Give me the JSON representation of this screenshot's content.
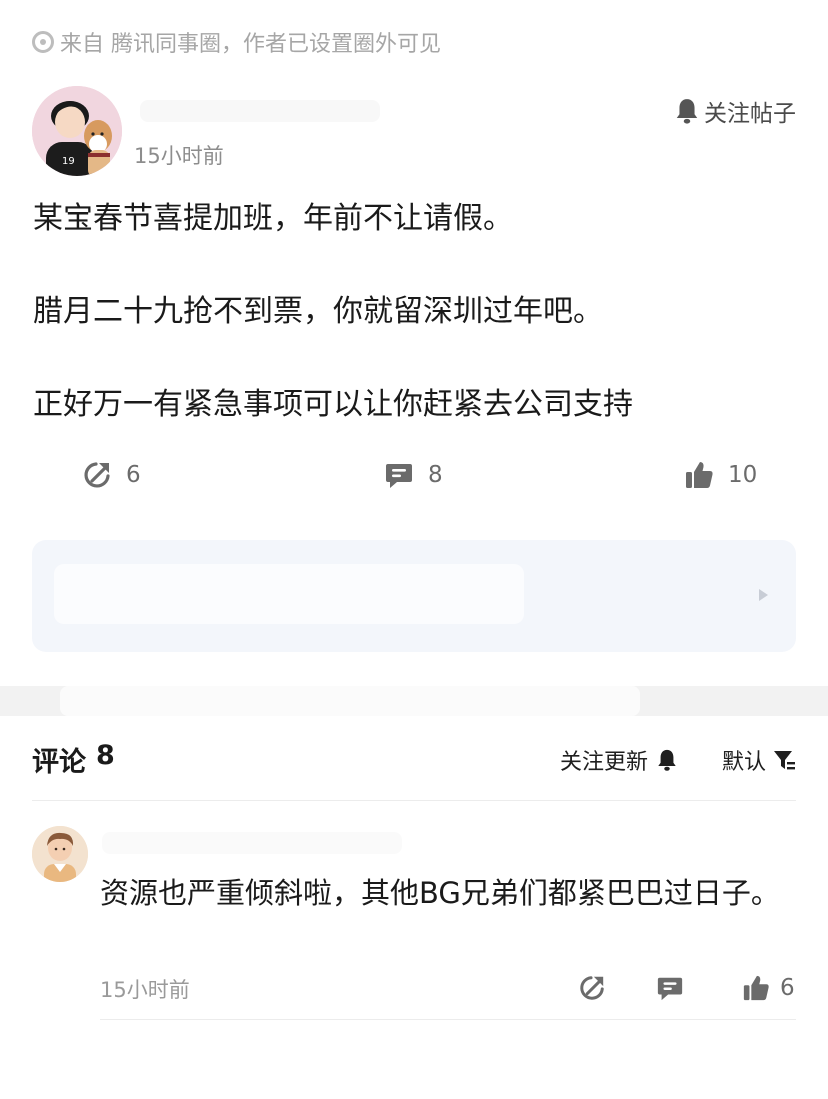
{
  "source": {
    "text": "来自 腾讯同事圈，作者已设置圈外可见"
  },
  "post": {
    "time": "15小时前",
    "follow_label": "关注帖子",
    "paragraphs": [
      "某宝春节喜提加班，年前不让请假。",
      "腊月二十九抢不到票，你就留深圳过年吧。",
      "正好万一有紧急事项可以让你赶紧去公司支持"
    ],
    "actions": {
      "share_count": "6",
      "comment_count": "8",
      "like_count": "10"
    }
  },
  "comments_section": {
    "title": "评论",
    "count": "8",
    "follow_update_label": "关注更新",
    "sort_label": "默认"
  },
  "comment": {
    "text": "资源也严重倾斜啦，其他BG兄弟们都紧巴巴过日子。",
    "time": "15小时前",
    "like_count": "6"
  },
  "colors": {
    "icon_gray": "#6b6b6b",
    "dark": "#1f1f1f",
    "muted": "#9a9a9a",
    "card_bg": "#f3f6fb"
  }
}
